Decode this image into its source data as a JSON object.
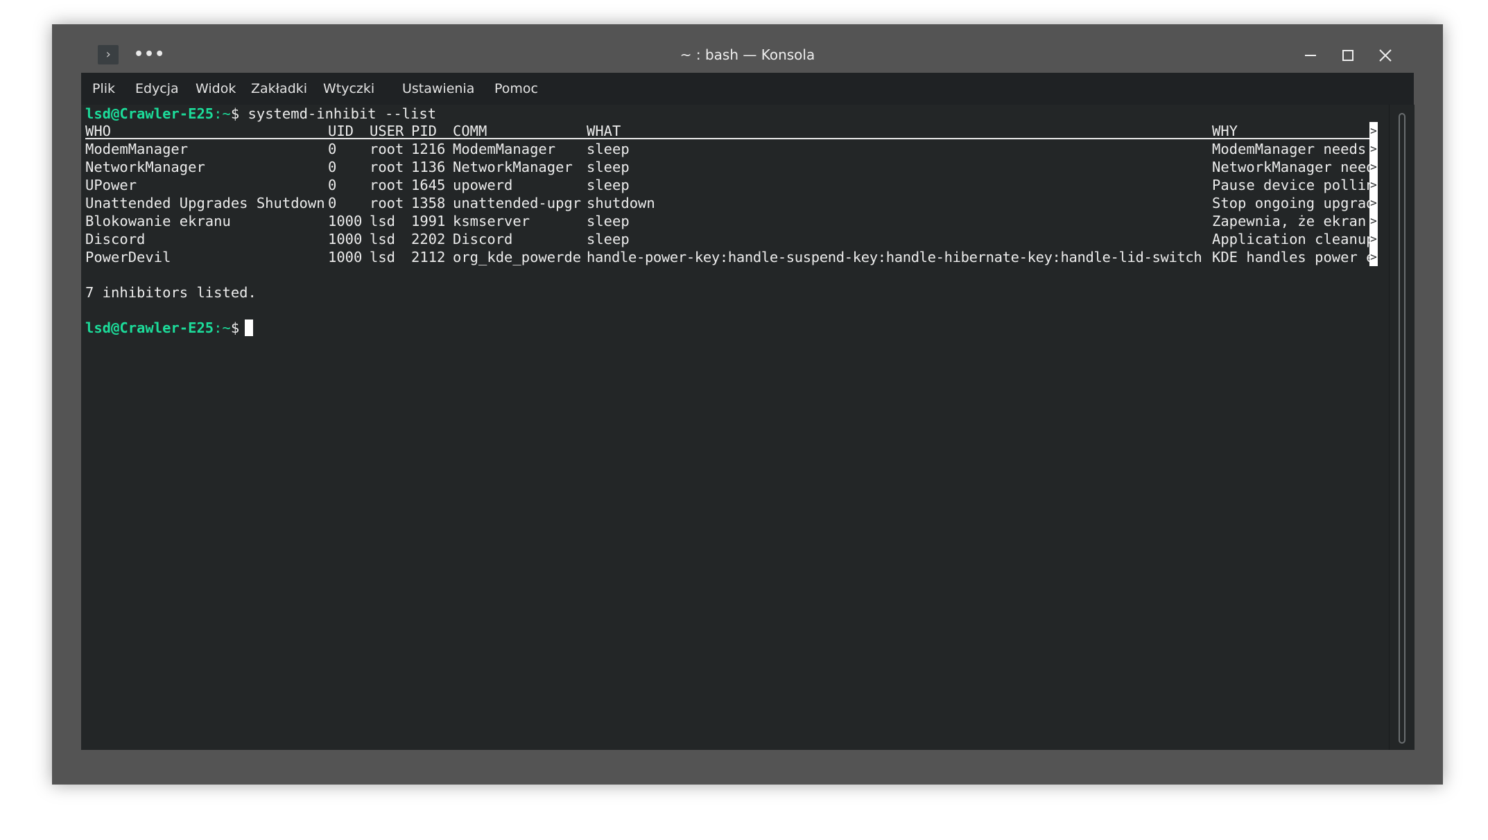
{
  "window": {
    "title": "~ : bash — Konsola",
    "icon": "terminal-chevron-icon",
    "more_icon": "more-dots-icon",
    "more_label": "•••",
    "buttons": [
      "minimize-icon",
      "maximize-icon",
      "close-icon"
    ]
  },
  "menubar": {
    "items": [
      "Plik",
      "Edycja",
      "Widok",
      "Zakładki",
      "Wtyczki",
      "Ustawienia",
      "Pomoc"
    ]
  },
  "terminal": {
    "prompt1": {
      "user_host": "lsd@Crawler-E25",
      "path": ":~",
      "symbol": "$",
      "command": " systemd-inhibit --list"
    },
    "headers": {
      "who": "WHO",
      "uid": "UID",
      "user": "USER",
      "pid": "PID",
      "comm": "COMM",
      "what": "WHAT",
      "why": "WHY"
    },
    "rows": [
      {
        "who": "ModemManager",
        "uid": "0",
        "user": "root",
        "pid": "1216",
        "comm": "ModemManager",
        "what": "sleep",
        "why": "ModemManager needs "
      },
      {
        "who": "NetworkManager",
        "uid": "0",
        "user": "root",
        "pid": "1136",
        "comm": "NetworkManager",
        "what": "sleep",
        "why": "NetworkManager need"
      },
      {
        "who": "UPower",
        "uid": "0",
        "user": "root",
        "pid": "1645",
        "comm": "upowerd",
        "what": "sleep",
        "why": "Pause device pollin"
      },
      {
        "who": "Unattended Upgrades Shutdown",
        "uid": "0",
        "user": "root",
        "pid": "1358",
        "comm": "unattended-upgr",
        "what": "shutdown",
        "why": "Stop ongoing upgrad"
      },
      {
        "who": "Blokowanie ekranu",
        "uid": "1000",
        "user": "lsd",
        "pid": "1991",
        "comm": "ksmserver",
        "what": "sleep",
        "why": "Zapewnia, że ekran "
      },
      {
        "who": "Discord",
        "uid": "1000",
        "user": "lsd",
        "pid": "2202",
        "comm": "Discord",
        "what": "sleep",
        "why": "Application cleanup"
      },
      {
        "who": "PowerDevil",
        "uid": "1000",
        "user": "lsd",
        "pid": "2112",
        "comm": "org_kde_powerde",
        "what": "handle-power-key:handle-suspend-key:handle-hibernate-key:handle-lid-switch",
        "why": "KDE handles power e"
      }
    ],
    "overflow_glyph": ">",
    "summary": "7 inhibitors listed.",
    "prompt2": {
      "user_host": "lsd@Crawler-E25",
      "path": ":~",
      "symbol": "$"
    }
  },
  "colors": {
    "frame": "#545454",
    "terminal_bg": "#232627",
    "menubar_bg": "#1f2224",
    "text": "#ececec",
    "prompt": "#1cdc9a"
  }
}
